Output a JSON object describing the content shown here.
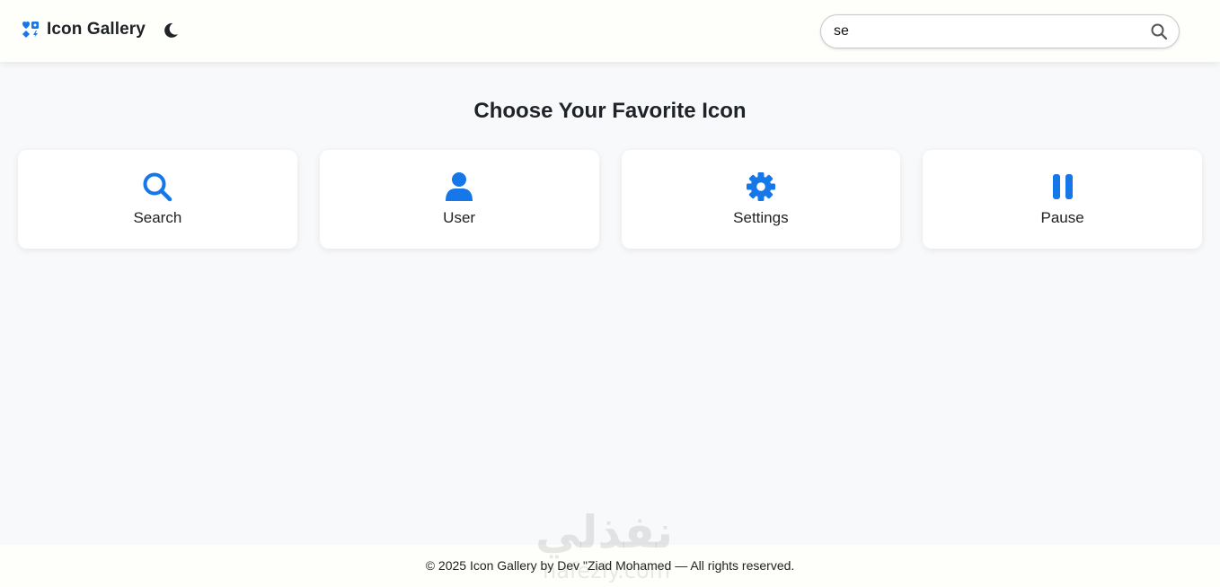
{
  "header": {
    "brand_icon": "icons-grid-icon",
    "title": "Icon Gallery",
    "theme_toggle_icon": "moon-icon",
    "search": {
      "value": "se",
      "placeholder": "",
      "button_icon": "search-icon"
    }
  },
  "main": {
    "heading": "Choose Your Favorite Icon",
    "icons": [
      {
        "label": "Search",
        "icon": "search-icon"
      },
      {
        "label": "User",
        "icon": "user-icon"
      },
      {
        "label": "Settings",
        "icon": "gear-icon"
      },
      {
        "label": "Pause",
        "icon": "pause-icon"
      }
    ]
  },
  "footer": {
    "text": "© 2025 Icon Gallery by Dev \"Ziad Mohamed — All rights reserved."
  },
  "watermark": {
    "arabic": "نفذلي",
    "latin": "nafezly.com"
  },
  "colors": {
    "accent": "#1677e8",
    "background": "#f8f9fb",
    "bar": "#fefefb",
    "card": "#ffffff"
  }
}
